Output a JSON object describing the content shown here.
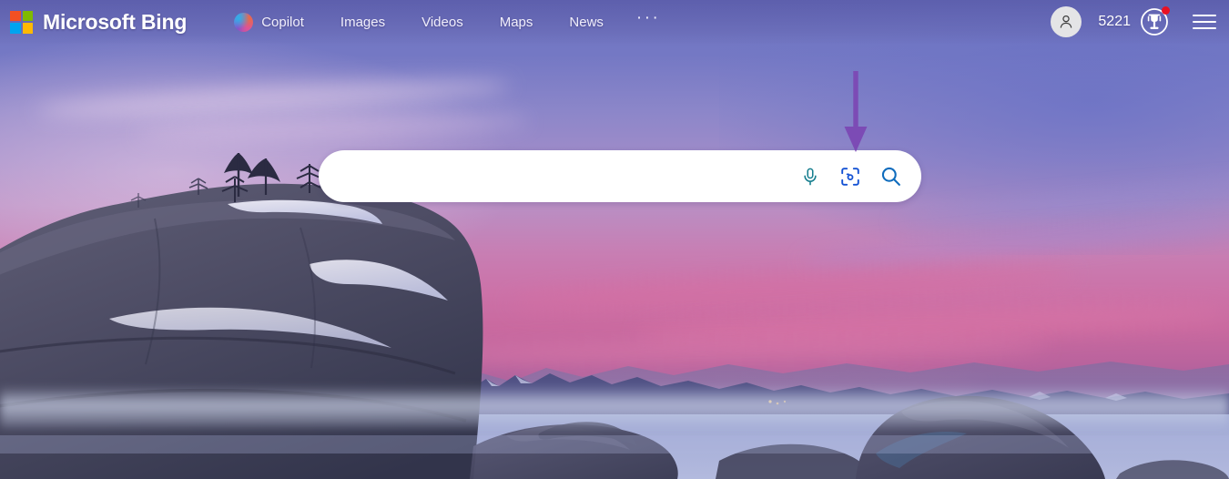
{
  "header": {
    "brand": {
      "name": "Microsoft Bing",
      "logo_icon": "microsoft-squares-icon",
      "logo_colors": [
        "#f25022",
        "#7fba00",
        "#00a4ef",
        "#ffb900"
      ]
    },
    "nav": [
      {
        "label": "Copilot",
        "icon": "copilot-icon"
      },
      {
        "label": "Images",
        "icon": null
      },
      {
        "label": "Videos",
        "icon": null
      },
      {
        "label": "Maps",
        "icon": null
      },
      {
        "label": "News",
        "icon": null
      }
    ],
    "more_label": "···",
    "right": {
      "avatar_icon": "person-avatar-icon",
      "rewards_count": "5221",
      "rewards_icon": "rewards-trophy-icon",
      "rewards_has_notification": true,
      "notification_color": "#e81123",
      "menu_icon": "hamburger-menu-icon"
    }
  },
  "search": {
    "value": "",
    "placeholder": "",
    "mic_icon": "microphone-icon",
    "visual_search_icon": "visual-search-camera-icon",
    "submit_icon": "search-magnifier-icon",
    "mic_color": "#177f8f",
    "visual_search_color": "#1452d4",
    "submit_color": "#0f6cbd"
  },
  "annotation": {
    "type": "arrow",
    "direction": "down",
    "color": "#7c4bb5",
    "points_at": "visual-search-camera-icon"
  },
  "background": {
    "scene": "lake-tahoe-bonsai-rock-sunset",
    "sky_top_color": "#6f74c0",
    "sky_mid_color": "#b98fc4",
    "sky_glow_color": "#cc72a8",
    "water_color": "#9aa6d2",
    "rock_color": "#4a4a63"
  }
}
